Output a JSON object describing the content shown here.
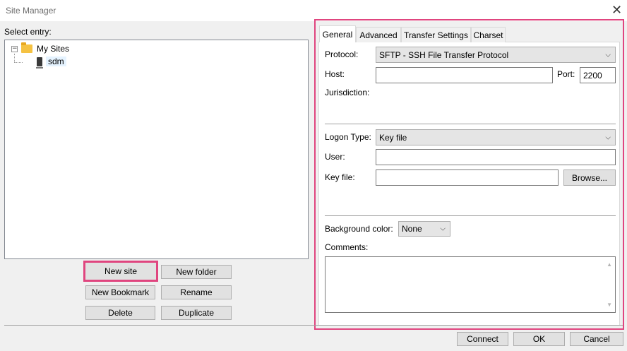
{
  "window": {
    "title": "Site Manager",
    "close_glyph": "✕"
  },
  "left": {
    "select_entry_label": "Select entry:",
    "tree": {
      "root": {
        "label": "My Sites",
        "expander": "−"
      },
      "children": [
        {
          "label": "sdm"
        }
      ]
    },
    "buttons": {
      "new_site": "New site",
      "new_folder": "New folder",
      "new_bookmark": "New Bookmark",
      "rename": "Rename",
      "delete": "Delete",
      "duplicate": "Duplicate"
    }
  },
  "tabs": [
    "General",
    "Advanced",
    "Transfer Settings",
    "Charset"
  ],
  "general": {
    "protocol_label": "Protocol:",
    "protocol_value": "SFTP - SSH File Transfer Protocol",
    "host_label": "Host:",
    "host_value": "",
    "port_label": "Port:",
    "port_value": "2200",
    "jurisdiction_label": "Jurisdiction:",
    "logon_type_label": "Logon Type:",
    "logon_type_value": "Key file",
    "user_label": "User:",
    "user_value": "",
    "key_file_label": "Key file:",
    "key_file_value": "",
    "browse_button": "Browse...",
    "background_color_label": "Background color:",
    "background_color_value": "None",
    "comments_label": "Comments:",
    "comments_value": ""
  },
  "footer": {
    "connect": "Connect",
    "ok": "OK",
    "cancel": "Cancel"
  },
  "colors": {
    "highlight": "#e0457f",
    "button_bg": "#e1e1e1",
    "window_bg": "#f0f0f0"
  },
  "icons": {
    "caret": "⌵",
    "scroll_up": "▲",
    "scroll_down": "▼"
  }
}
